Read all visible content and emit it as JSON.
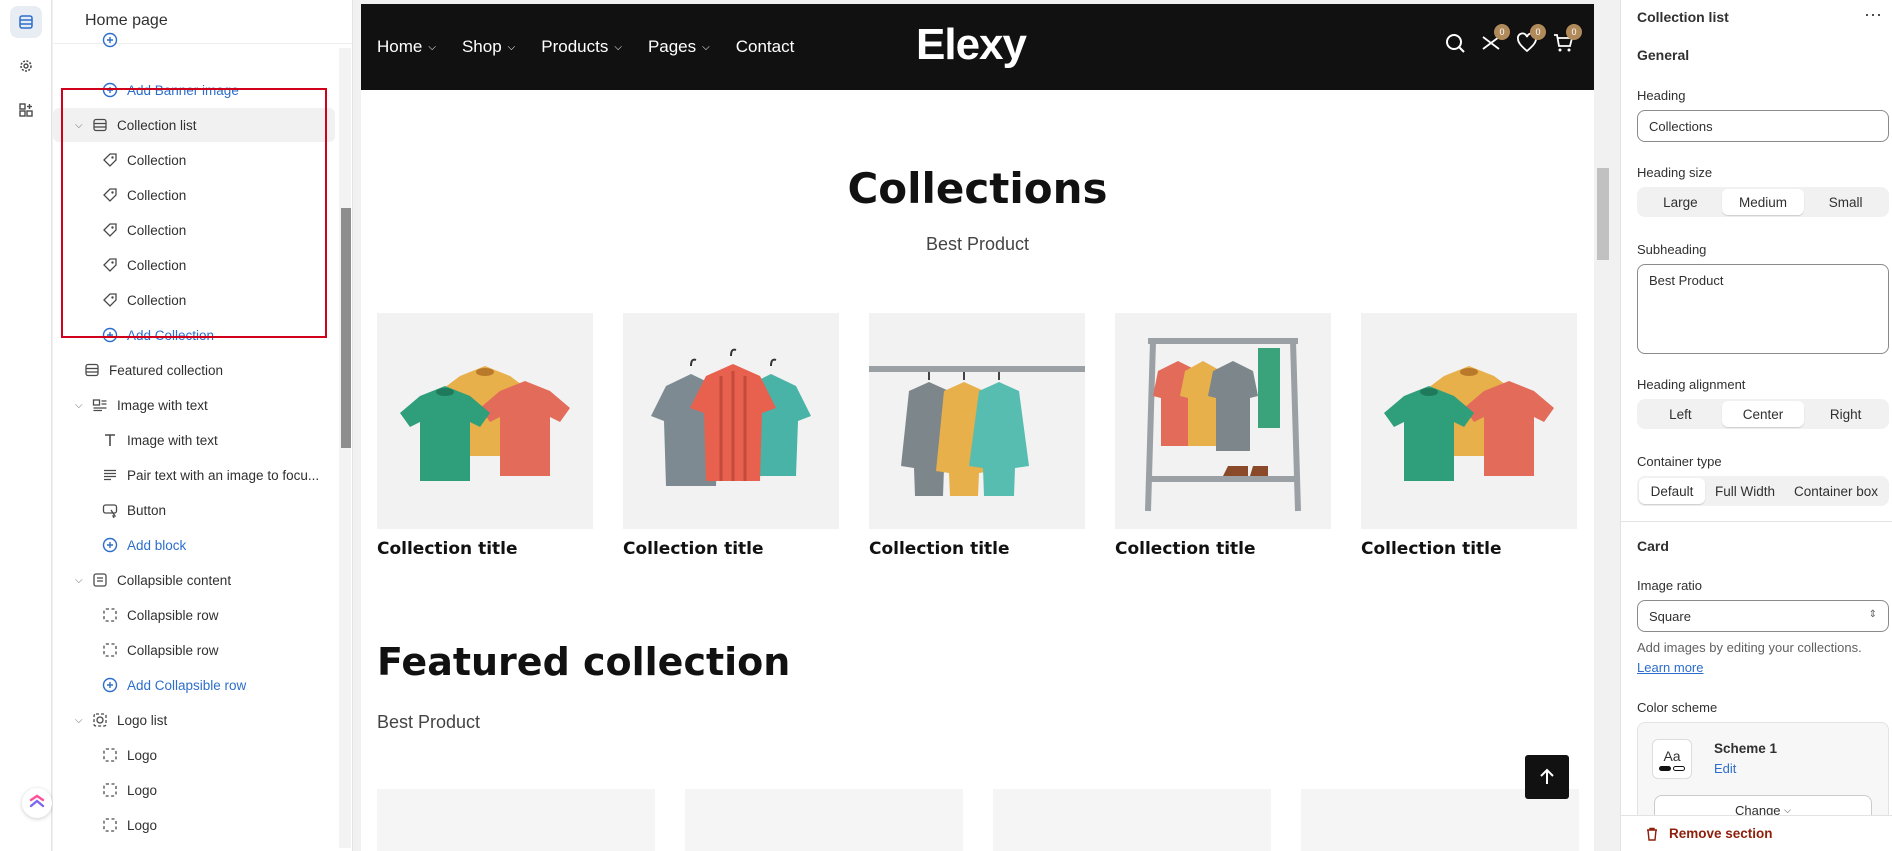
{
  "sidebar": {
    "title": "Home page",
    "items": [
      {
        "label": "",
        "type": "add",
        "icon": "plus-circle-icon"
      },
      {
        "label": "Add Banner image",
        "type": "add",
        "icon": "plus-circle-icon"
      },
      {
        "label": "Collection list",
        "type": "section",
        "icon": "section-icon",
        "expanded": true,
        "selected": true
      },
      {
        "label": "Collection",
        "type": "block",
        "icon": "tag-icon"
      },
      {
        "label": "Collection",
        "type": "block",
        "icon": "tag-icon"
      },
      {
        "label": "Collection",
        "type": "block",
        "icon": "tag-icon"
      },
      {
        "label": "Collection",
        "type": "block",
        "icon": "tag-icon"
      },
      {
        "label": "Collection",
        "type": "block",
        "icon": "tag-icon"
      },
      {
        "label": "Add Collection",
        "type": "add",
        "icon": "plus-circle-icon"
      },
      {
        "label": "Featured collection",
        "type": "section-plain",
        "icon": "section-icon"
      },
      {
        "label": "Image with text",
        "type": "section",
        "icon": "image-text-icon",
        "expanded": true
      },
      {
        "label": "Image with text",
        "type": "block",
        "icon": "text-icon"
      },
      {
        "label": "Pair text with an image to focu...",
        "type": "block",
        "icon": "paragraph-icon"
      },
      {
        "label": "Button",
        "type": "block",
        "icon": "button-icon"
      },
      {
        "label": "Add block",
        "type": "add",
        "icon": "plus-circle-icon"
      },
      {
        "label": "Collapsible content",
        "type": "section",
        "icon": "collapsible-icon",
        "expanded": true
      },
      {
        "label": "Collapsible row",
        "type": "block",
        "icon": "dashed-square-icon"
      },
      {
        "label": "Collapsible row",
        "type": "block",
        "icon": "dashed-square-icon"
      },
      {
        "label": "Add Collapsible row",
        "type": "add",
        "icon": "plus-circle-icon"
      },
      {
        "label": "Logo list",
        "type": "section",
        "icon": "logo-list-icon",
        "expanded": true
      },
      {
        "label": "Logo",
        "type": "block",
        "icon": "dashed-square-icon"
      },
      {
        "label": "Logo",
        "type": "block",
        "icon": "dashed-square-icon"
      },
      {
        "label": "Logo",
        "type": "block",
        "icon": "dashed-square-icon"
      }
    ]
  },
  "preview": {
    "nav": [
      "Home",
      "Shop",
      "Products",
      "Pages",
      "Contact"
    ],
    "logo": "Elexy",
    "badges": [
      "0",
      "0",
      "0"
    ],
    "collections": {
      "title": "Collections",
      "subtitle": "Best Product",
      "cards": [
        {
          "title": "Collection title",
          "image": "folded-tshirts"
        },
        {
          "title": "Collection title",
          "image": "hanging-shirts"
        },
        {
          "title": "Collection title",
          "image": "sweaters-on-rail"
        },
        {
          "title": "Collection title",
          "image": "clothes-rack"
        },
        {
          "title": "Collection title",
          "image": "folded-tshirts"
        }
      ]
    },
    "featured": {
      "title": "Featured collection",
      "subtitle": "Best Product"
    }
  },
  "panel": {
    "title": "Collection list",
    "general": "General",
    "heading_label": "Heading",
    "heading_value": "Collections",
    "heading_size_label": "Heading size",
    "heading_size_options": [
      "Large",
      "Medium",
      "Small"
    ],
    "heading_size_selected": "Medium",
    "subheading_label": "Subheading",
    "subheading_value": "Best Product",
    "alignment_label": "Heading alignment",
    "alignment_options": [
      "Left",
      "Center",
      "Right"
    ],
    "alignment_selected": "Center",
    "container_label": "Container type",
    "container_options": [
      "Default",
      "Full Width",
      "Container box"
    ],
    "container_selected": "Default",
    "card": "Card",
    "ratio_label": "Image ratio",
    "ratio_value": "Square",
    "help_text": "Add images by editing your collections.",
    "learn_more": "Learn more",
    "scheme_label": "Color scheme",
    "scheme_swatch": "Aa",
    "scheme_name": "Scheme 1",
    "scheme_edit": "Edit",
    "scheme_change": "Change",
    "remove": "Remove section"
  }
}
